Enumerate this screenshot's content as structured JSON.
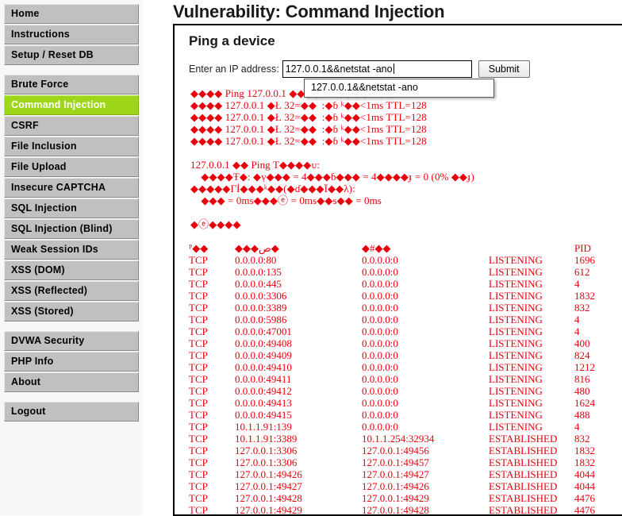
{
  "sidebar": {
    "groups": [
      {
        "items": [
          {
            "label": "Home",
            "active": false
          },
          {
            "label": "Instructions",
            "active": false
          },
          {
            "label": "Setup / Reset DB",
            "active": false
          }
        ]
      },
      {
        "items": [
          {
            "label": "Brute Force",
            "active": false
          },
          {
            "label": "Command Injection",
            "active": true
          },
          {
            "label": "CSRF",
            "active": false
          },
          {
            "label": "File Inclusion",
            "active": false
          },
          {
            "label": "File Upload",
            "active": false
          },
          {
            "label": "Insecure CAPTCHA",
            "active": false
          },
          {
            "label": "SQL Injection",
            "active": false
          },
          {
            "label": "SQL Injection (Blind)",
            "active": false
          },
          {
            "label": "Weak Session IDs",
            "active": false
          },
          {
            "label": "XSS (DOM)",
            "active": false
          },
          {
            "label": "XSS (Reflected)",
            "active": false
          },
          {
            "label": "XSS (Stored)",
            "active": false
          }
        ]
      },
      {
        "items": [
          {
            "label": "DVWA Security",
            "active": false
          },
          {
            "label": "PHP Info",
            "active": false
          },
          {
            "label": "About",
            "active": false
          }
        ]
      },
      {
        "items": [
          {
            "label": "Logout",
            "active": false
          }
        ]
      }
    ]
  },
  "main": {
    "page_title": "Vulnerability: Command Injection",
    "section_heading": "Ping a device",
    "form": {
      "ip_label": "Enter an IP address:",
      "ip_value": "127.0.0.1&&netstat -ano",
      "ip_placeholder": "",
      "submit_label": "Submit"
    },
    "autocomplete": {
      "visible": true,
      "options": [
        "127.0.0.1&&netstat -ano"
      ]
    }
  },
  "output": {
    "accent_color": "#e8000d",
    "ping_lines": [
      "◆◆◆◆ Ping 127.0.0.1 ◆◆◆◆ 32 ◆◆◆◆◆◆◆:",
      "◆◆◆◆ 127.0.0.1 ◆Ł 32=◆◆  :◆ɓ ᵏ◆◆<1ms TTL=128",
      "◆◆◆◆ 127.0.0.1 ◆Ł 32=◆◆  :◆ɓ ᵏ◆◆<1ms TTL=128",
      "◆◆◆◆ 127.0.0.1 ◆Ł 32=◆◆  :◆ɓ ᵏ◆◆<1ms TTL=128",
      "◆◆◆◆ 127.0.0.1 ◆Ł 32=◆◆  :◆ɓ ᵏ◆◆<1ms TTL=128"
    ],
    "stats_lines": [
      "127.0.0.1 ◆◆ Ping T◆◆◆◆ᴜ:",
      "    ◆◆◆◆Ŧ◆: ◆ṿ◆◆◆ = 4◆◆◆ɓ◆◆◆ = 4◆◆◆◆ɟ = 0 (0% ◆◆ɟ)",
      "◆◆◆◆◆Γİ◆◆◆ᵏ◆◆(◆ɗ◆◆◆Ï◆◆λ):",
      "    ◆◆◆ = 0ms◆◆◆ⓔ = 0ms◆◆ѕ◆◆ = 0ms"
    ],
    "netstat_title": "◆ⓔ◆◆◆◆",
    "netstat_headers": {
      "proto": "ᴾ◆◆",
      "local": "◆◆◆ص◆",
      "foreign": "◆#◆◆",
      "state": "",
      "pid": "PID"
    },
    "netstat_rows": [
      {
        "proto": "TCP",
        "local": "0.0.0.0:80",
        "foreign": "0.0.0.0:0",
        "state": "LISTENING",
        "pid": "1696"
      },
      {
        "proto": "TCP",
        "local": "0.0.0.0:135",
        "foreign": "0.0.0.0:0",
        "state": "LISTENING",
        "pid": "612"
      },
      {
        "proto": "TCP",
        "local": "0.0.0.0:445",
        "foreign": "0.0.0.0:0",
        "state": "LISTENING",
        "pid": "4"
      },
      {
        "proto": "TCP",
        "local": "0.0.0.0:3306",
        "foreign": "0.0.0.0:0",
        "state": "LISTENING",
        "pid": "1832"
      },
      {
        "proto": "TCP",
        "local": "0.0.0.0:3389",
        "foreign": "0.0.0.0:0",
        "state": "LISTENING",
        "pid": "832"
      },
      {
        "proto": "TCP",
        "local": "0.0.0.0:5986",
        "foreign": "0.0.0.0:0",
        "state": "LISTENING",
        "pid": "4"
      },
      {
        "proto": "TCP",
        "local": "0.0.0.0:47001",
        "foreign": "0.0.0.0:0",
        "state": "LISTENING",
        "pid": "4"
      },
      {
        "proto": "TCP",
        "local": "0.0.0.0:49408",
        "foreign": "0.0.0.0:0",
        "state": "LISTENING",
        "pid": "400"
      },
      {
        "proto": "TCP",
        "local": "0.0.0.0:49409",
        "foreign": "0.0.0.0:0",
        "state": "LISTENING",
        "pid": "824"
      },
      {
        "proto": "TCP",
        "local": "0.0.0.0:49410",
        "foreign": "0.0.0.0:0",
        "state": "LISTENING",
        "pid": "1212"
      },
      {
        "proto": "TCP",
        "local": "0.0.0.0:49411",
        "foreign": "0.0.0.0:0",
        "state": "LISTENING",
        "pid": "816"
      },
      {
        "proto": "TCP",
        "local": "0.0.0.0:49412",
        "foreign": "0.0.0.0:0",
        "state": "LISTENING",
        "pid": "480"
      },
      {
        "proto": "TCP",
        "local": "0.0.0.0:49413",
        "foreign": "0.0.0.0:0",
        "state": "LISTENING",
        "pid": "1624"
      },
      {
        "proto": "TCP",
        "local": "0.0.0.0:49415",
        "foreign": "0.0.0.0:0",
        "state": "LISTENING",
        "pid": "488"
      },
      {
        "proto": "TCP",
        "local": "10.1.1.91:139",
        "foreign": "0.0.0.0:0",
        "state": "LISTENING",
        "pid": "4"
      },
      {
        "proto": "TCP",
        "local": "10.1.1.91:3389",
        "foreign": "10.1.1.254:32934",
        "state": "ESTABLISHED",
        "pid": "832"
      },
      {
        "proto": "TCP",
        "local": "127.0.0.1:3306",
        "foreign": "127.0.0.1:49456",
        "state": "ESTABLISHED",
        "pid": "1832"
      },
      {
        "proto": "TCP",
        "local": "127.0.0.1:3306",
        "foreign": "127.0.0.1:49457",
        "state": "ESTABLISHED",
        "pid": "1832"
      },
      {
        "proto": "TCP",
        "local": "127.0.0.1:49426",
        "foreign": "127.0.0.1:49427",
        "state": "ESTABLISHED",
        "pid": "4044"
      },
      {
        "proto": "TCP",
        "local": "127.0.0.1:49427",
        "foreign": "127.0.0.1:49426",
        "state": "ESTABLISHED",
        "pid": "4044"
      },
      {
        "proto": "TCP",
        "local": "127.0.0.1:49428",
        "foreign": "127.0.0.1:49429",
        "state": "ESTABLISHED",
        "pid": "4476"
      },
      {
        "proto": "TCP",
        "local": "127.0.0.1:49429",
        "foreign": "127.0.0.1:49428",
        "state": "ESTABLISHED",
        "pid": "4476"
      }
    ]
  }
}
